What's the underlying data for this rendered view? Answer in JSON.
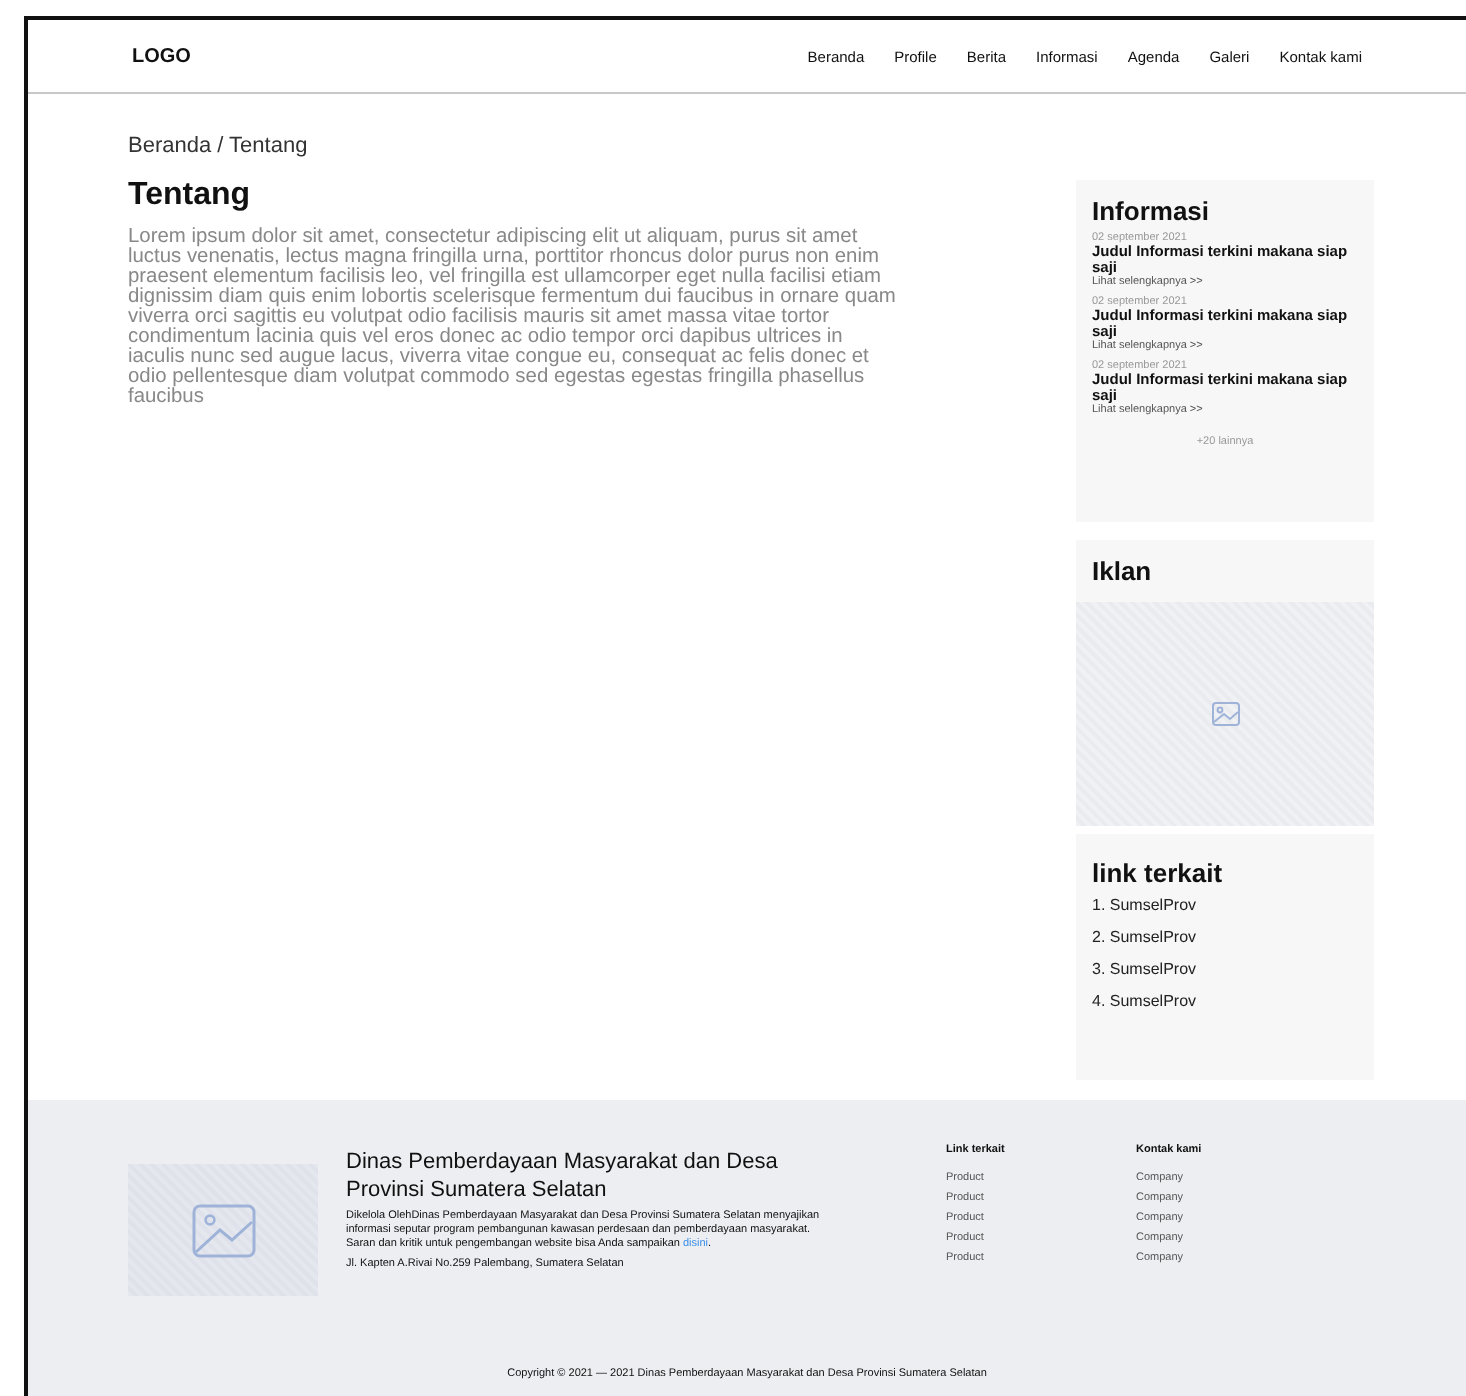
{
  "header": {
    "logo": "LOGO",
    "nav": [
      "Beranda",
      "Profile",
      "Berita",
      "Informasi",
      "Agenda",
      "Galeri",
      "Kontak kami"
    ]
  },
  "breadcrumb": "Beranda / Tentang",
  "article": {
    "title": "Tentang",
    "body": "Lorem ipsum dolor sit amet, consectetur adipiscing elit ut aliquam, purus sit amet luctus venenatis, lectus magna fringilla urna, porttitor rhoncus dolor purus non enim praesent elementum facilisis leo, vel fringilla est ullamcorper eget nulla facilisi etiam dignissim diam quis enim lobortis scelerisque fermentum dui faucibus in ornare quam viverra orci sagittis eu volutpat odio facilisis mauris sit amet massa vitae tortor condimentum lacinia quis vel eros donec ac odio tempor orci dapibus ultrices in iaculis nunc sed augue lacus, viverra vitae congue eu, consequat ac felis donec et odio pellentesque diam volutpat commodo sed egestas egestas fringilla phasellus faucibus"
  },
  "sidebar": {
    "informasi": {
      "title": "Informasi",
      "items": [
        {
          "date": "02 september 2021",
          "title": "Judul Informasi terkini makana siap saji",
          "link": "Lihat selengkapnya >>"
        },
        {
          "date": "02 september 2021",
          "title": "Judul Informasi terkini makana siap saji",
          "link": "Lihat selengkapnya >>"
        },
        {
          "date": "02 september 2021",
          "title": "Judul Informasi terkini makana siap saji",
          "link": "Lihat selengkapnya >>"
        }
      ],
      "more": "+20 lainnya"
    },
    "iklan": {
      "title": "Iklan"
    },
    "links": {
      "title": "link terkait",
      "items": [
        "1. SumselProv",
        "2. SumselProv",
        "3. SumselProv",
        "4. SumselProv"
      ]
    }
  },
  "footer": {
    "org": "Dinas Pemberdayaan Masyarakat dan Desa Provinsi Sumatera Selatan",
    "description": "Dikelola OlehDinas Pemberdayaan Masyarakat dan Desa Provinsi Sumatera Selatan menyajikan informasi seputar program pembangunan kawasan perdesaan dan pemberdayaan masyarakat. Saran dan kritik untuk pengembangan website bisa Anda sampaikan",
    "link": "disini",
    "link_after": ".",
    "address": "Jl. Kapten A.Rivai No.259 Palembang, Sumatera Selatan",
    "columns": [
      {
        "title": "Link terkait",
        "items": [
          "Product",
          "Product",
          "Product",
          "Product",
          "Product"
        ]
      },
      {
        "title": "Kontak kami",
        "items": [
          "Company",
          "Company",
          "Company",
          "Company",
          "Company"
        ]
      }
    ],
    "copyright": "Copyright © 2021 — 2021 Dinas Pemberdayaan Masyarakat dan Desa Provinsi Sumatera Selatan"
  }
}
